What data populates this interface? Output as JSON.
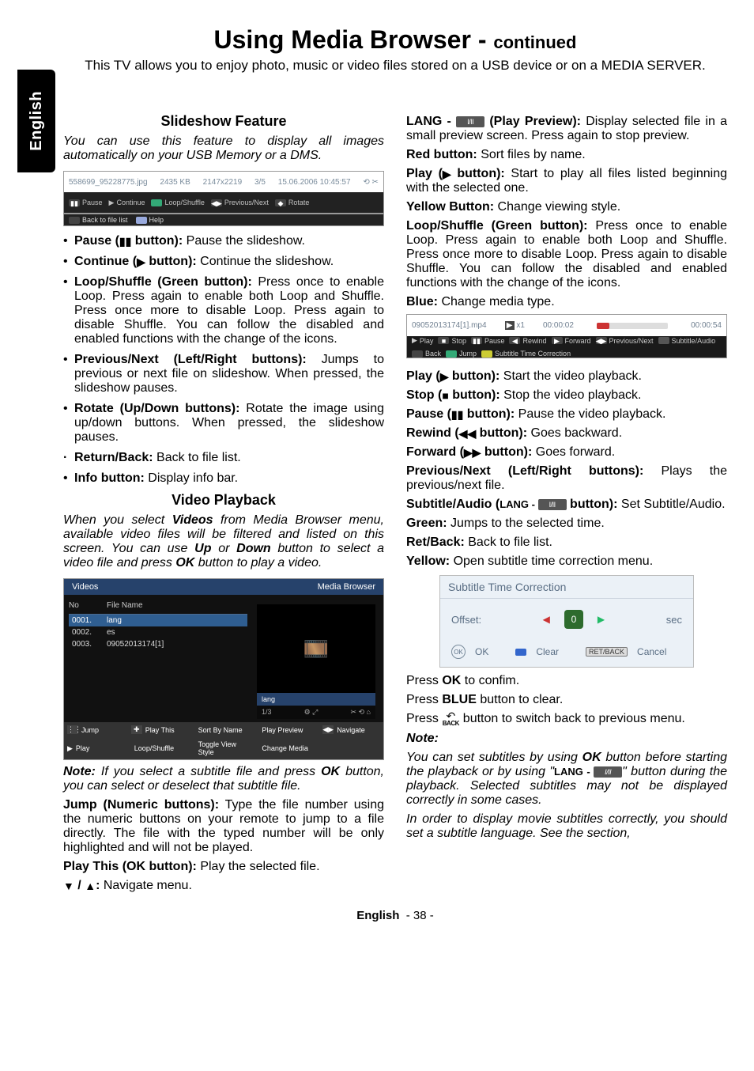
{
  "lang_tab": "English",
  "title_main": "Using Media Browser - ",
  "title_cont": "continued",
  "intro": "This TV allows you to enjoy photo, music or video files stored on a USB device or on a MEDIA SERVER.",
  "footer_lang": "English",
  "footer_page": "- 38 -",
  "left": {
    "slideshow_head": "Slideshow Feature",
    "slideshow_lead": "You can use this feature to display all images automatically on your USB Memory or a DMS.",
    "shot_slide": {
      "filename": "558699_95228775.jpg",
      "size": "2435 KB",
      "dims": "2147x2219",
      "idx": "3/5",
      "date": "15.06.2006 10:45:57",
      "pause": "Pause",
      "continue": "Continue",
      "loop": "Loop/Shuffle",
      "prevnext": "Previous/Next",
      "rotate": "Rotate",
      "back": "Back to file list",
      "help": "Help"
    },
    "bul1_b": "Pause (",
    "bul1_b2": " button):",
    "bul1_t": " Pause the slideshow.",
    "bul2_b": "Continue (",
    "bul2_b2": " button):",
    "bul2_t": " Continue the slideshow.",
    "bul3_b": "Loop/Shuffle (Green button):",
    "bul3_t": " Press once to enable Loop. Press again to enable both Loop and Shuffle. Press once more to disable Loop. Press again to disable Shuffle. You can follow the disabled and enabled functions with the change of the icons.",
    "bul4_b": "Previous/Next (Left/Right buttons):",
    "bul4_t": " Jumps to previous or next file on slideshow. When pressed, the slideshow pauses.",
    "bul5_b": "Rotate (Up/Down buttons):",
    "bul5_t": " Rotate the image using up/down buttons. When pressed, the slideshow pauses.",
    "bul6_b": "Return/Back:",
    "bul6_t": " Back to file list.",
    "bul7_b": "Info button:",
    "bul7_t": " Display info bar.",
    "video_head": "Video Playback",
    "video_lead_1": "When you select ",
    "video_lead_b1": "Videos",
    "video_lead_2": " from Media Browser menu, available video files will be filtered and listed on this screen. You can use ",
    "video_lead_b2": "Up",
    "video_lead_3": " or ",
    "video_lead_b3": "Down",
    "video_lead_4": " button to select a video file and press ",
    "video_lead_b4": "OK",
    "video_lead_5": " button to play a video.",
    "shot_video": {
      "title": "Videos",
      "crumb": "Media Browser",
      "col_no": "No",
      "col_name": "File Name",
      "r1_no": "0001.",
      "r1_name": "lang",
      "r2_no": "0002.",
      "r2_name": "es",
      "r3_no": "0003.",
      "r3_name": "09052013174[1]",
      "prev_caption": "lang",
      "prev_idx": "1/3",
      "f_jump": "Jump",
      "f_play": "Play",
      "f_playthis": "Play This",
      "f_loop": "Loop/Shuffle",
      "f_sort": "Sort By Name",
      "f_style": "Toggle View Style",
      "f_prev": "Play Preview",
      "f_media": "Change Media",
      "f_nav": "Navigate"
    },
    "note_label": "Note:",
    "note_text": " If you select a subtitle file and press ",
    "note_b": "OK",
    "note_text2": " button, you can select or deselect that subtitle file.",
    "jump_b": "Jump (Numeric buttons):",
    "jump_t": " Type the file number using the numeric buttons on your remote to jump to a file directly. The file with the typed number will be only highlighted and will not be played.",
    "playthis_b": "Play This (OK button):",
    "playthis_t": " Play the selected file.",
    "nav_b": " / ",
    "nav_b2": ":",
    "nav_t": " Navigate menu."
  },
  "right": {
    "lang_label": "LANG - ",
    "lang_icon": "I/II",
    "lang_b": " (Play Preview):",
    "lang_t": " Display selected file in a small preview screen. Press again to stop preview.",
    "red_b": "Red button:",
    "red_t": " Sort files by name.",
    "play_b1": "Play (",
    "play_b2": " button):",
    "play_t": " Start to play all files listed beginning with the selected one.",
    "yel_b": "Yellow Button:",
    "yel_t": " Change viewing style.",
    "loop_b": "Loop/Shuffle (Green button):",
    "loop_t": " Press once to enable Loop. Press again to enable both Loop and Shuffle. Press once more to disable Loop. Press again to disable Shuffle. You can follow the disabled and enabled functions with the change of the icons.",
    "blue_b": "Blue:",
    "blue_t": " Change media type.",
    "shot_play": {
      "file": "09052013174[1].mp4",
      "speed": "x1",
      "elapsed": "00:00:02",
      "total": "00:00:54",
      "play": "Play",
      "stop": "Stop",
      "pause": "Pause",
      "rew": "Rewind",
      "fwd": "Forward",
      "prev": "Previous/Next",
      "sub": "Subtitle/Audio",
      "back": "Back",
      "jump": "Jump",
      "corr": "Subtitle Time Correction"
    },
    "p_play_b1": "Play (",
    "p_play_b2": " button):",
    "p_play_t": " Start the video playback.",
    "p_stop_b1": "Stop (",
    "p_stop_b2": " button):",
    "p_stop_t": " Stop the video playback.",
    "p_pause_b1": "Pause (",
    "p_pause_b2": " button):",
    "p_pause_t": " Pause the video playback.",
    "p_rew_b1": "Rewind (",
    "p_rew_b2": " button):",
    "p_rew_t": " Goes backward.",
    "p_fwd_b1": "Forward (",
    "p_fwd_b2": " button):",
    "p_fwd_t": " Goes forward.",
    "p_pn_b": "Previous/Next (Left/Right buttons):",
    "p_pn_t": " Plays the previous/next file.",
    "p_sa_b1": "Subtitle/Audio (",
    "p_sa_lbl": "LANG - ",
    "p_sa_b2": " button):",
    "p_sa_t": " Set Subtitle/Audio.",
    "p_gr_b": "Green:",
    "p_gr_t": " Jumps to the selected time.",
    "p_rb_b": "Ret/Back:",
    "p_rb_t": " Back to file list.",
    "p_ye_b": "Yellow:",
    "p_ye_t": " Open subtitle time correction menu.",
    "shot_sub": {
      "head": "Subtitle Time Correction",
      "offset": "Offset:",
      "sec": "sec",
      "ok": "OK",
      "clear": "Clear",
      "cancel": "Cancel",
      "retback": "RET/BACK"
    },
    "press_ok_1": "Press ",
    "press_ok_b": "OK",
    "press_ok_2": " to confim.",
    "press_blue_1": "Press ",
    "press_blue_b": "BLUE",
    "press_blue_2": " button to clear.",
    "press_back_1": "Press ",
    "press_back_2": " button to switch back to previous menu.",
    "note_head": "Note:",
    "note1_1": "You can set subtitles by using ",
    "note1_b1": "OK",
    "note1_2": " button before starting the playback or by using \"",
    "note1_lbl": "LANG - ",
    "note1_3": "\" button during the playback. Selected subtitles may not be displayed correctly in some cases.",
    "note2": "In order to display movie subtitles correctly, you should set a subtitle language. See the section,"
  }
}
